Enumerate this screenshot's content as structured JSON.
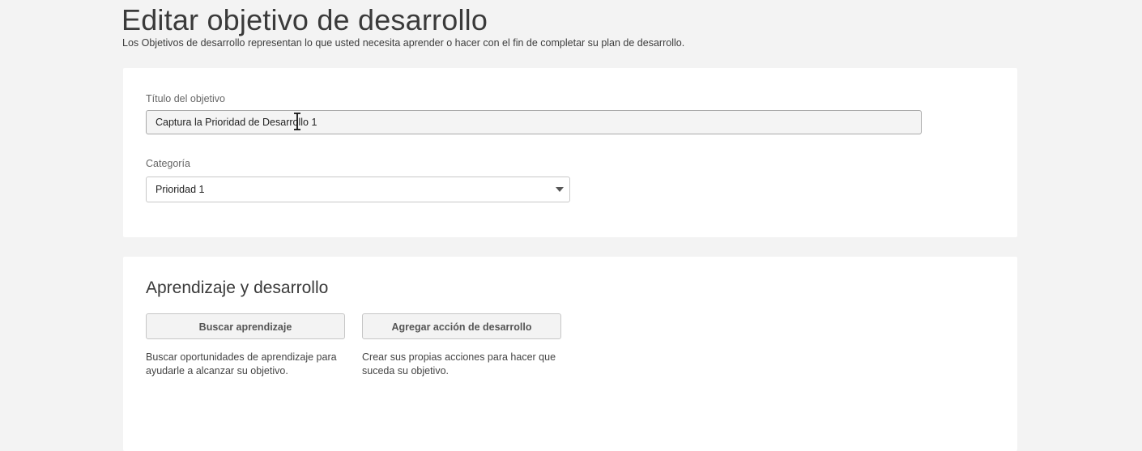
{
  "header": {
    "title": "Editar objetivo de desarrollo",
    "subtitle": "Los Objetivos de desarrollo representan lo que usted necesita aprender o hacer con el fin de completar su plan de desarrollo."
  },
  "goal_form": {
    "title_label": "Título del objetivo",
    "title_value": "Captura la Prioridad de Desarrollo 1",
    "category_label": "Categoría",
    "category_selected": "Prioridad 1"
  },
  "learning": {
    "section_title": "Aprendizaje y desarrollo",
    "search_button_label": "Buscar aprendizaje",
    "search_help": "Buscar oportunidades de aprendizaje para ayudarle a alcanzar su objetivo.",
    "add_button_label": "Agregar acción de desarrollo",
    "add_help": "Crear sus propias acciones para hacer que suceda su objetivo."
  },
  "icons": {
    "cursor": "text-cursor-icon",
    "dropdown": "chevron-down-icon"
  }
}
